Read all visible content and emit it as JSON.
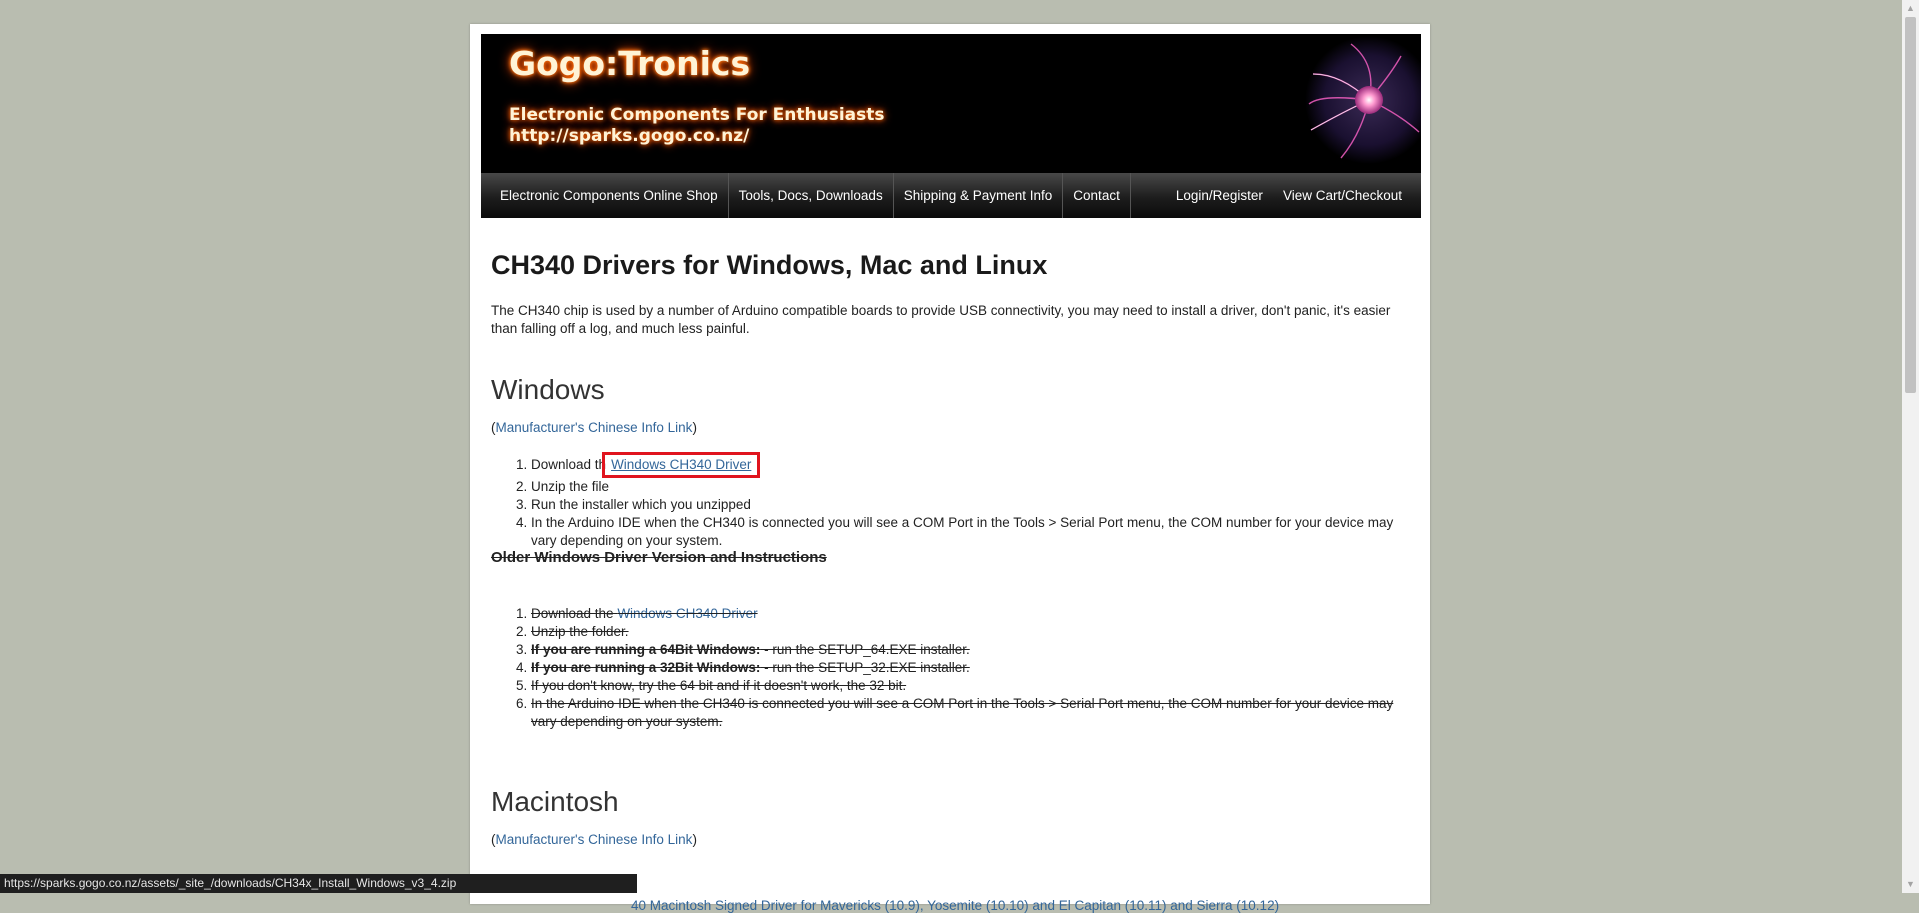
{
  "banner": {
    "brand": "Gogo:Tronics",
    "tagline_line1": "Electronic Components For Enthusiasts",
    "tagline_line2": "http://sparks.gogo.co.nz/"
  },
  "nav": {
    "items": [
      {
        "label": "Electronic Components Online Shop"
      },
      {
        "label": "Tools, Docs, Downloads"
      },
      {
        "label": "Shipping & Payment Info"
      },
      {
        "label": "Contact"
      }
    ],
    "right_items": [
      {
        "label": "Login/Register"
      },
      {
        "label": "View Cart/Checkout"
      }
    ]
  },
  "page": {
    "title": "CH340 Drivers for Windows, Mac and Linux",
    "intro": "The CH340 chip is used by a number of Arduino compatible boards to provide USB connectivity, you may need to install a driver, don't panic, it's easier than falling off a log, and much less painful."
  },
  "windows": {
    "heading": "Windows",
    "info_link": "Manufacturer's Chinese Info Link",
    "steps": {
      "s1_prefix": "Download th",
      "s1_link": "Windows CH340 Driver",
      "s2": "Unzip the file",
      "s3": "Run the installer which you unzipped",
      "s4": "In the Arduino IDE when the CH340 is connected you will see a COM Port in the Tools > Serial Port menu, the COM number for your device may vary depending on your system."
    },
    "older_heading": "Older Windows Driver Version and Instructions",
    "older": {
      "o1_prefix": "Download the ",
      "o1_link": "Windows CH340 Driver",
      "o2": "Unzip the folder.",
      "o3_bold": "If you are running a 64Bit Windows:",
      "o3_rest": " - run the SETUP_64.EXE installer.",
      "o4_bold": "If you are running a 32Bit Windows:",
      "o4_rest": " - run the SETUP_32.EXE installer.",
      "o5": "If you don't know, try the 64 bit and if it doesn't work, the 32 bit.",
      "o6": "In the Arduino IDE when the CH340 is connected you will see a COM Port in the Tools > Serial Port menu, the COM number for your device may vary depending on your system."
    }
  },
  "mac": {
    "heading": "Macintosh",
    "info_link": "Manufacturer's Chinese Info Link",
    "driver_link_visible": "40 Macintosh Signed Driver for Mavericks (10.9), Yosemite (10.10) and El Capitan (10.11) and Sierra (10.12)"
  },
  "status_bar": {
    "url": "https://sparks.gogo.co.nz/assets/_site_/downloads/CH34x_Install_Windows_v3_4.zip"
  },
  "colors": {
    "background": "#b9bdb0",
    "link": "#336699",
    "highlight_box": "#e0141e"
  }
}
